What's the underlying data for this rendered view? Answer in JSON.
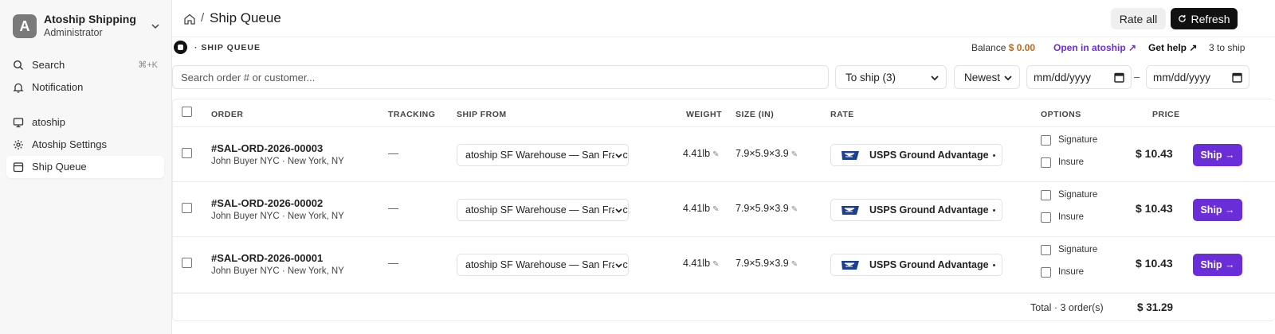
{
  "workspace": {
    "avatar_letter": "A",
    "name": "Atoship Shipping",
    "role": "Administrator"
  },
  "sidebar": {
    "items": [
      {
        "label": "Search",
        "shortcut": "⌘+K",
        "icon": "search-icon"
      },
      {
        "label": "Notification",
        "icon": "bell-icon"
      },
      {
        "label": "atoship",
        "icon": "monitor-icon"
      },
      {
        "label": "Atoship Settings",
        "icon": "gear-icon"
      },
      {
        "label": "Ship Queue",
        "icon": "calendar-icon",
        "active": true
      }
    ]
  },
  "header": {
    "separator": "/",
    "title": "Ship Queue",
    "rate_all_label": "Rate all",
    "refresh_label": "Refresh"
  },
  "section": {
    "title": "· SHIP QUEUE",
    "balance_label": "Balance",
    "balance_value": "$ 0.00",
    "open_link": "Open in atoship ↗",
    "help_link": "Get help ↗",
    "to_ship_count": "3 to ship"
  },
  "filters": {
    "search_placeholder": "Search order # or customer...",
    "status_selected": "To ship (3)",
    "sort_selected": "Newest",
    "date_from_placeholder": "mm/dd/yyyy",
    "date_separator": "–",
    "date_to_placeholder": "mm/dd/yyyy"
  },
  "table": {
    "columns": {
      "order": "ORDER",
      "tracking": "TRACKING",
      "ship_from": "SHIP FROM",
      "weight": "WEIGHT",
      "size": "SIZE (IN)",
      "rate": "RATE",
      "options": "OPTIONS",
      "price": "PRICE"
    },
    "rows": [
      {
        "order_id": "#SAL-ORD-2026-00003",
        "customer": "John Buyer NYC · New York, NY",
        "tracking": "—",
        "ship_from": "atoship SF Warehouse — San Francisco",
        "weight": "4.41lb",
        "size": "7.9×5.9×3.9",
        "rate": "USPS Ground Advantage",
        "opt1": "Signature",
        "opt2": "Insure",
        "price": "$ 10.43",
        "ship_label": "Ship →"
      },
      {
        "order_id": "#SAL-ORD-2026-00002",
        "customer": "John Buyer NYC · New York, NY",
        "tracking": "—",
        "ship_from": "atoship SF Warehouse — San Francisco",
        "weight": "4.41lb",
        "size": "7.9×5.9×3.9",
        "rate": "USPS Ground Advantage",
        "opt1": "Signature",
        "opt2": "Insure",
        "price": "$ 10.43",
        "ship_label": "Ship →"
      },
      {
        "order_id": "#SAL-ORD-2026-00001",
        "customer": "John Buyer NYC · New York, NY",
        "tracking": "—",
        "ship_from": "atoship SF Warehouse — San Francisco",
        "weight": "4.41lb",
        "size": "7.9×5.9×3.9",
        "rate": "USPS Ground Advantage",
        "opt1": "Signature",
        "opt2": "Insure",
        "price": "$ 10.43",
        "ship_label": "Ship →"
      }
    ],
    "total_label": "Total · 3 order(s)",
    "total_value": "$ 31.29"
  },
  "colors": {
    "accent": "#6a2ed8",
    "balance": "#c0661a",
    "refresh_bg": "#111111",
    "usps_blue": "#1e3f8f"
  }
}
